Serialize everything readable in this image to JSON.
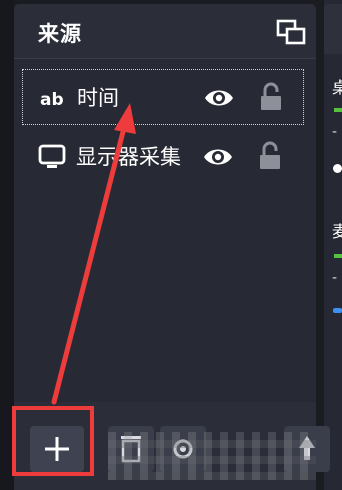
{
  "sources": {
    "title": "来源",
    "items": [
      {
        "label": "时间",
        "type_icon": "text-gdi-icon",
        "visible": true,
        "locked": false,
        "selected": true
      },
      {
        "label": "显示器采集",
        "type_icon": "monitor-icon",
        "visible": true,
        "locked": false,
        "selected": false
      }
    ]
  },
  "toolbar": {
    "add_icon": "plus-icon",
    "remove_icon": "trash-icon",
    "properties_icon": "gear-icon",
    "move_up_icon": "up-arrow-icon"
  },
  "right_panel": {
    "line1": "桌",
    "line2": "-",
    "line3": "麦",
    "line4": "-"
  },
  "annotation": {
    "color": "#ee3b3b"
  },
  "colors": {
    "panel_bg": "#2b2e38",
    "list_bg": "#272a34",
    "button_bg": "#3f4250",
    "text": "#ffffff",
    "meter_green": "#55c240",
    "accent_blue": "#3d8ff0"
  }
}
